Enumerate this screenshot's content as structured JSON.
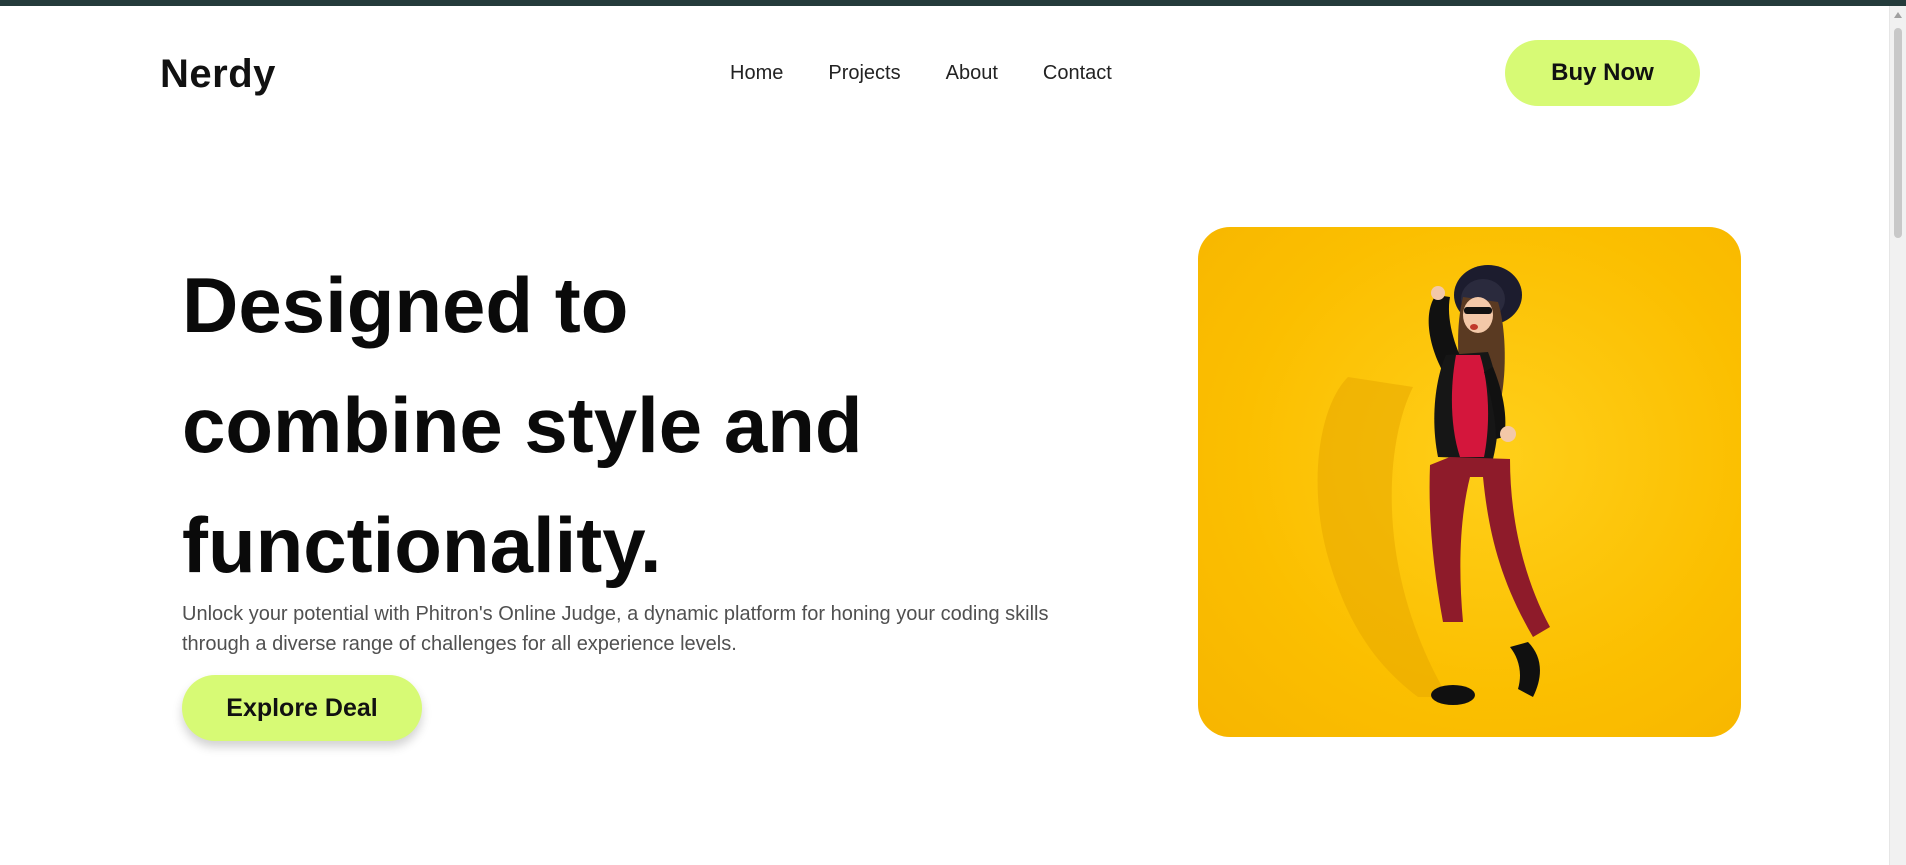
{
  "header": {
    "brand": "Nerdy",
    "nav": [
      "Home",
      "Projects",
      "About",
      "Contact"
    ],
    "cta_label": "Buy Now"
  },
  "hero": {
    "title": "Designed to combine style and functionality.",
    "description": "Unlock your potential with Phitron's Online Judge, a dynamic platform for honing your coding skills through a diverse range of challenges for all experience levels.",
    "cta_label": "Explore Deal"
  },
  "colors": {
    "accent": "#d7fa75",
    "image_background": "#fbbf00",
    "top_bar": "#243b3b"
  }
}
